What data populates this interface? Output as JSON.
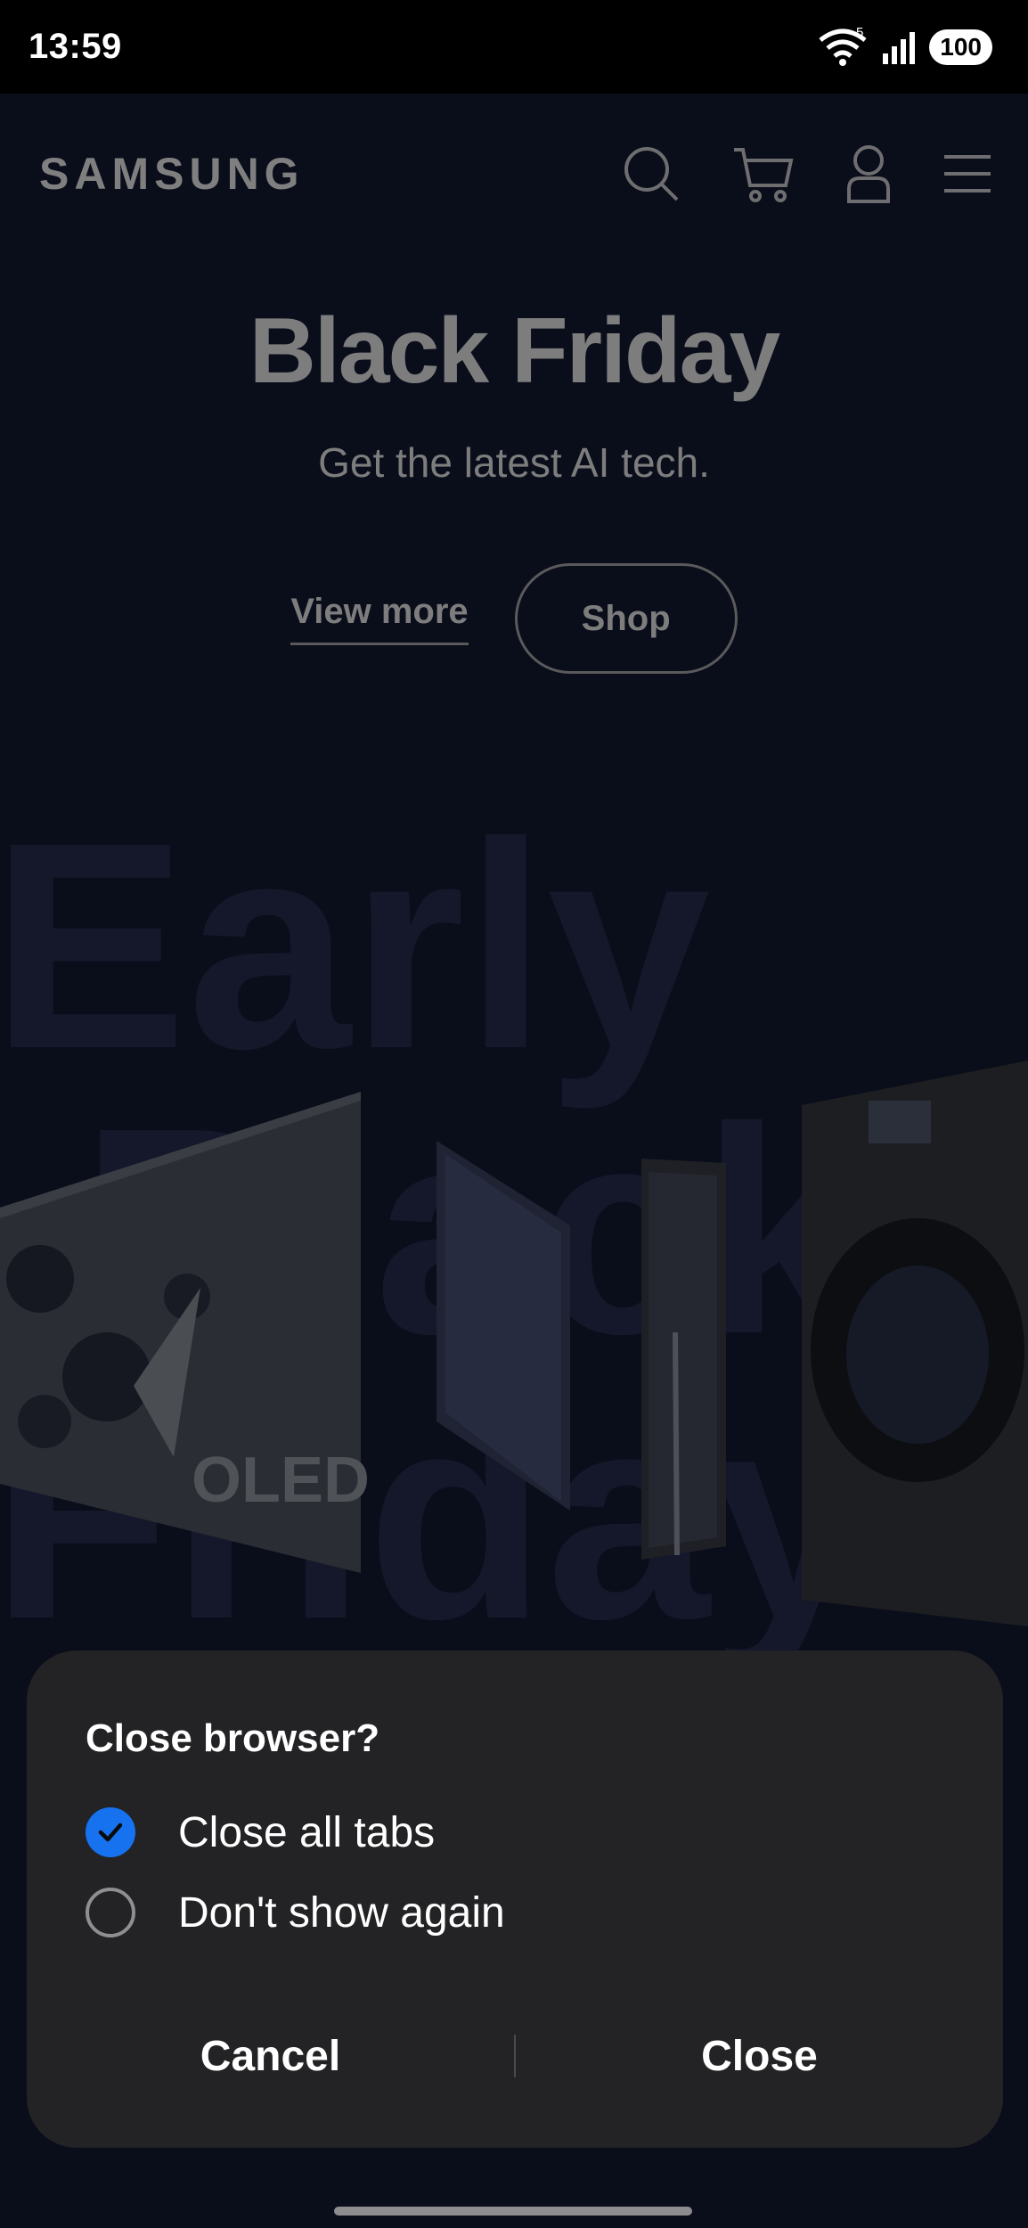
{
  "status_bar": {
    "time": "13:59",
    "network_label": "5",
    "battery": "100"
  },
  "header": {
    "logo": "SAMSUNG",
    "icons": [
      "search-icon",
      "cart-icon",
      "account-icon",
      "menu-icon"
    ]
  },
  "hero": {
    "title": "Black Friday",
    "subtitle": "Get the latest AI tech.",
    "view_more": "View more",
    "shop": "Shop"
  },
  "promo": {
    "background_text": [
      "Early",
      "Black",
      "Friday"
    ],
    "oled_label": "OLED"
  },
  "dialog": {
    "title": "Close browser?",
    "options": [
      {
        "label": "Close all tabs",
        "checked": true
      },
      {
        "label": "Don't show again",
        "checked": false
      }
    ],
    "cancel": "Cancel",
    "close": "Close"
  },
  "colors": {
    "page_background": "#0a0d1a",
    "dialog_background": "#232325",
    "checkbox_accent": "#1672ef"
  }
}
